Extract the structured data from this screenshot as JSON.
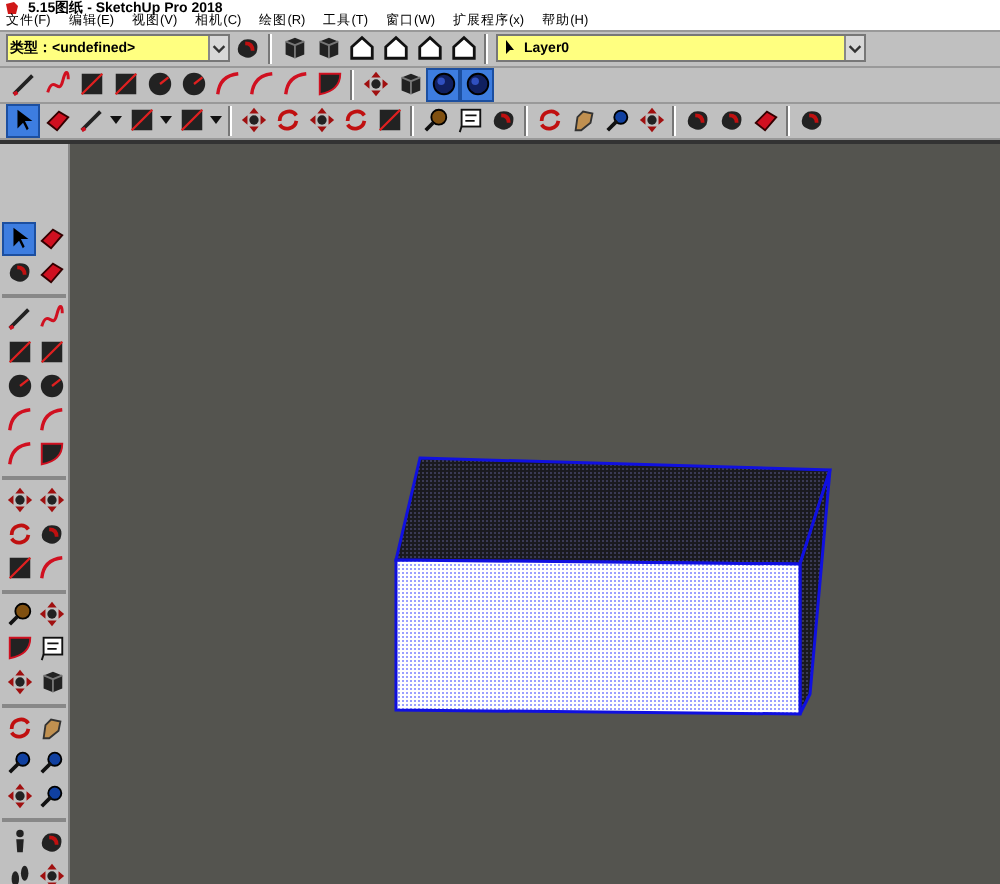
{
  "window": {
    "title": "5.15图纸 - SketchUp Pro 2018"
  },
  "menu": [
    "文件(F)",
    "编辑(E)",
    "视图(V)",
    "相机(C)",
    "绘图(R)",
    "工具(T)",
    "窗口(W)",
    "扩展程序(x)",
    "帮助(H)"
  ],
  "toolbar_rows": [
    {
      "items": [
        {
          "kind": "dropdown",
          "value": "类型：<undefined>"
        },
        {
          "kind": "blob",
          "selected": false
        },
        {
          "kind": "separator"
        },
        {
          "kind": "cube",
          "selected": false
        },
        {
          "kind": "cube",
          "selected": false
        },
        {
          "kind": "house",
          "selected": false
        },
        {
          "kind": "house",
          "selected": false
        },
        {
          "kind": "house",
          "selected": false
        },
        {
          "kind": "house",
          "selected": false
        },
        {
          "kind": "separator"
        },
        {
          "kind": "layer",
          "value": "Layer0"
        }
      ]
    },
    {
      "items": [
        {
          "kind": "pencil",
          "selected": false
        },
        {
          "kind": "freehand",
          "selected": false
        },
        {
          "kind": "rect",
          "selected": false
        },
        {
          "kind": "rect",
          "selected": false
        },
        {
          "kind": "circle",
          "selected": false
        },
        {
          "kind": "circle",
          "selected": false
        },
        {
          "kind": "arc",
          "selected": false
        },
        {
          "kind": "arc",
          "selected": false
        },
        {
          "kind": "arc",
          "selected": false
        },
        {
          "kind": "pie",
          "selected": false
        },
        {
          "kind": "separator"
        },
        {
          "kind": "move",
          "selected": false
        },
        {
          "kind": "cube",
          "selected": false
        },
        {
          "kind": "sphere",
          "selected": true
        },
        {
          "kind": "sphere",
          "selected": true
        }
      ]
    },
    {
      "items": [
        {
          "kind": "select",
          "selected": true
        },
        {
          "kind": "eraser",
          "selected": false
        },
        {
          "kind": "pencil",
          "selected": false
        },
        {
          "kind": "caret"
        },
        {
          "kind": "rect",
          "selected": false
        },
        {
          "kind": "caret"
        },
        {
          "kind": "rect",
          "selected": false
        },
        {
          "kind": "caret"
        },
        {
          "kind": "separator"
        },
        {
          "kind": "move",
          "selected": false
        },
        {
          "kind": "rotate",
          "selected": false
        },
        {
          "kind": "move",
          "selected": false
        },
        {
          "kind": "rotate",
          "selected": false
        },
        {
          "kind": "rect",
          "selected": false
        },
        {
          "kind": "separator"
        },
        {
          "kind": "tape",
          "selected": false
        },
        {
          "kind": "label",
          "selected": false
        },
        {
          "kind": "blob",
          "selected": false
        },
        {
          "kind": "separator"
        },
        {
          "kind": "rotate",
          "selected": false
        },
        {
          "kind": "hand",
          "selected": false
        },
        {
          "kind": "zoom",
          "selected": false
        },
        {
          "kind": "move",
          "selected": false
        },
        {
          "kind": "separator"
        },
        {
          "kind": "blob",
          "selected": false
        },
        {
          "kind": "blob",
          "selected": false
        },
        {
          "kind": "eraser",
          "selected": false
        },
        {
          "kind": "separator"
        },
        {
          "kind": "blob",
          "selected": false
        }
      ]
    }
  ],
  "side_groups": [
    {
      "items": [
        {
          "kind": "select",
          "selected": true
        },
        {
          "kind": "eraser",
          "selected": false
        },
        {
          "kind": "blob",
          "selected": false
        },
        {
          "kind": "eraser",
          "selected": false
        }
      ]
    },
    {
      "items": [
        {
          "kind": "pencil",
          "selected": false
        },
        {
          "kind": "freehand",
          "selected": false
        },
        {
          "kind": "rect",
          "selected": false
        },
        {
          "kind": "rect",
          "selected": false
        },
        {
          "kind": "circle",
          "selected": false
        },
        {
          "kind": "circle",
          "selected": false
        },
        {
          "kind": "arc",
          "selected": false
        },
        {
          "kind": "arc",
          "selected": false
        },
        {
          "kind": "arc",
          "selected": false
        },
        {
          "kind": "pie",
          "selected": false
        }
      ]
    },
    {
      "items": [
        {
          "kind": "move",
          "selected": false
        },
        {
          "kind": "move",
          "selected": false
        },
        {
          "kind": "rotate",
          "selected": false
        },
        {
          "kind": "blob",
          "selected": false
        },
        {
          "kind": "rect",
          "selected": false
        },
        {
          "kind": "arc",
          "selected": false
        }
      ]
    },
    {
      "items": [
        {
          "kind": "tape",
          "selected": false
        },
        {
          "kind": "move",
          "selected": false
        },
        {
          "kind": "pie",
          "selected": false
        },
        {
          "kind": "label",
          "selected": false
        },
        {
          "kind": "move",
          "selected": false
        },
        {
          "kind": "cube",
          "selected": false
        }
      ]
    },
    {
      "items": [
        {
          "kind": "rotate",
          "selected": false
        },
        {
          "kind": "hand",
          "selected": false
        },
        {
          "kind": "zoom",
          "selected": false
        },
        {
          "kind": "zoom",
          "selected": false
        },
        {
          "kind": "move",
          "selected": false
        },
        {
          "kind": "zoom",
          "selected": false
        }
      ]
    },
    {
      "items": [
        {
          "kind": "figure",
          "selected": false
        },
        {
          "kind": "blob",
          "selected": false
        },
        {
          "kind": "footprints",
          "selected": false
        },
        {
          "kind": "move",
          "selected": false
        }
      ]
    }
  ]
}
